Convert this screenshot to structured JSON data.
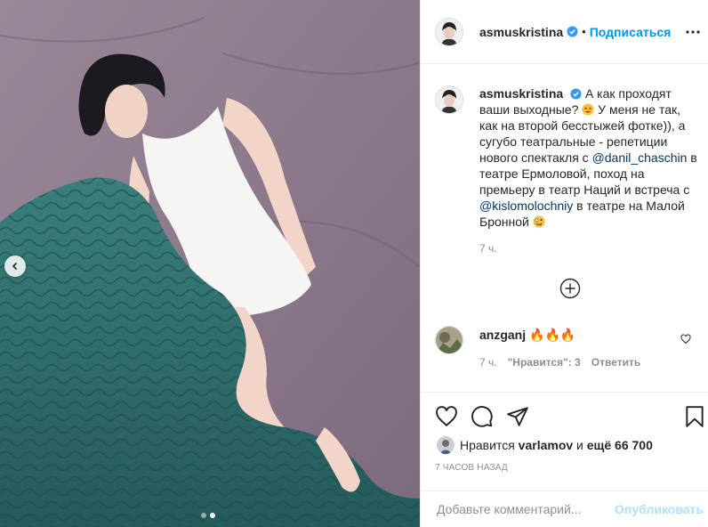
{
  "post": {
    "username": "asmuskristina",
    "separator": "•",
    "follow_label": "Подписаться"
  },
  "caption": {
    "username": "asmuskristina",
    "text_1": "А как проходят ваши выходные?",
    "text_2": "У меня не так, как на второй бесстыжей фотке)), а сугубо театральные - репетиции нового спектакля с",
    "mention_1": "@danil_chaschin",
    "text_3": "в театре Ермоловой, поход на премьеру в театр Наций и встреча с",
    "mention_2": "@kislomolochniy",
    "text_4": "в театре на Малой Бронной",
    "time": "7 ч."
  },
  "comment": {
    "username": "anzganj",
    "emoji_text": "🔥🔥🔥",
    "time": "7 ч.",
    "likes": "\"Нравится\": 3",
    "reply": "Ответить"
  },
  "liked_by": {
    "prefix": "Нравится",
    "user": "varlamov",
    "middle": "и",
    "count": "ещё 66 700"
  },
  "post_time": "7 ЧАСОВ НАЗАД",
  "add_comment": {
    "placeholder": "Добавьте комментарий...",
    "publish_label": "Опубликовать"
  },
  "colors": {
    "accent": "#0095f6",
    "publish_disabled": "#b2dffc",
    "blanket": "#2c6e6e",
    "sheet": "#8a7888"
  }
}
